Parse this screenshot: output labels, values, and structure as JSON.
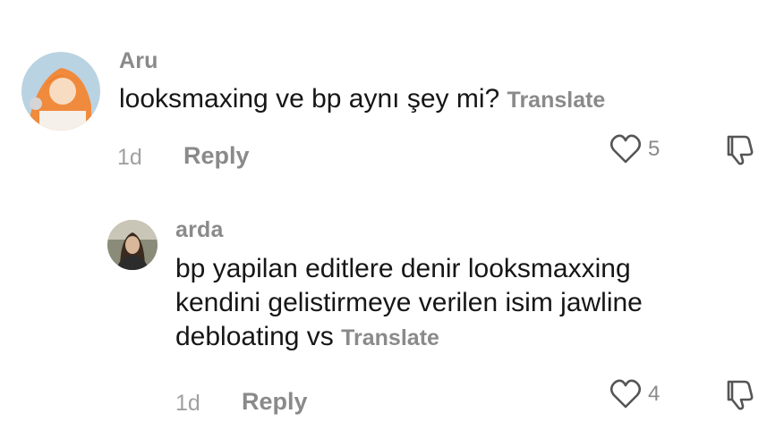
{
  "comments": [
    {
      "username": "Aru",
      "text": "looksmaxing ve bp aynı şey mi?",
      "translate_label": "Translate",
      "time": "1d",
      "reply_label": "Reply",
      "likes": "5"
    },
    {
      "username": "arda",
      "text_lines": [
        "bp yapilan editlere denir looksmaxxing",
        "kendini gelistirmeye verilen isim jawline",
        "debloating vs"
      ],
      "translate_label": "Translate",
      "time": "1d",
      "reply_label": "Reply",
      "likes": "4"
    }
  ],
  "icons": {
    "like": "heart-outline-icon",
    "dislike": "thumbs-down-outline-icon"
  },
  "colors": {
    "muted_text": "#8a8a8a",
    "body_text": "#161616",
    "icon_stroke": "#555555"
  }
}
